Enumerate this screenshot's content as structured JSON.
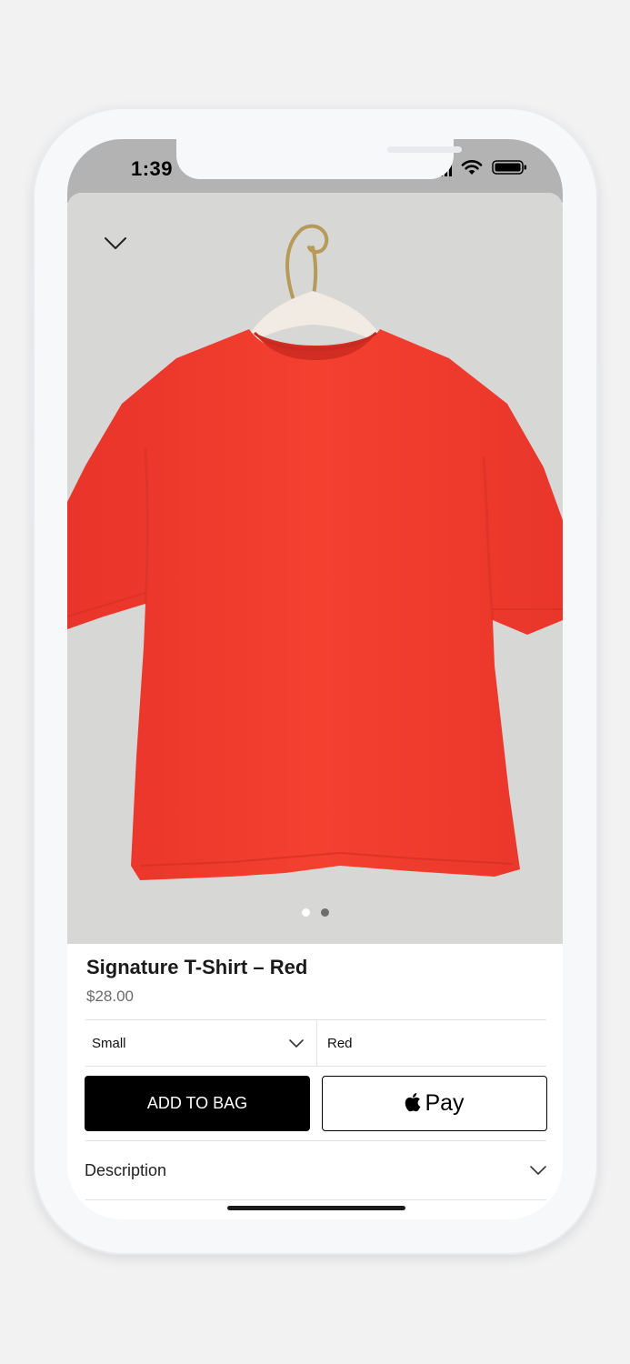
{
  "status_bar": {
    "time": "1:39"
  },
  "icons": {
    "close": "chevron-down-icon",
    "apple": "apple-logo-icon",
    "expand": "chevron-down-icon"
  },
  "colors": {
    "shirt": "#f2392c",
    "hero_bg": "#d7d7d5",
    "button_dark": "#000000",
    "price": "#6b6b6b"
  },
  "product": {
    "title": "Signature T-Shirt – Red",
    "price": "$28.00",
    "image_count": 2,
    "active_image": 1
  },
  "options": {
    "size": "Small",
    "color": "Red"
  },
  "actions": {
    "add_to_bag": "ADD TO BAG",
    "apple_pay": "Pay"
  },
  "sections": {
    "description": "Description"
  }
}
